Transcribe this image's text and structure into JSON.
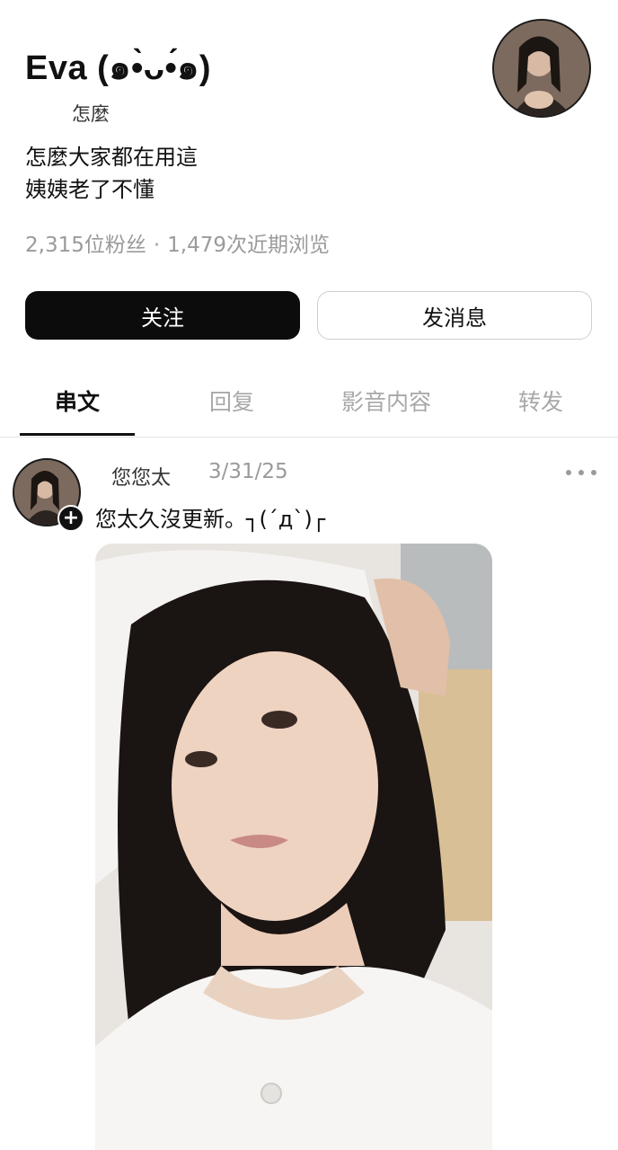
{
  "profile": {
    "display_name": "Eva (๑•̀ᴗ•́๑)",
    "username": "怎麼",
    "bio_lines": [
      "怎麼大家都在用這",
      "姨姨老了不懂"
    ],
    "followers": "2,315位粉丝",
    "separator": "·",
    "views": "1,479次近期浏览"
  },
  "buttons": {
    "follow": "关注",
    "message": "发消息"
  },
  "tabs": [
    {
      "label": "串文",
      "active": true
    },
    {
      "label": "回复",
      "active": false
    },
    {
      "label": "影音内容",
      "active": false
    },
    {
      "label": "转发",
      "active": false
    }
  ],
  "post": {
    "author": "您您太",
    "date": "3/31/25",
    "text": "您太久沒更新。┐(´д`)┌",
    "follow_icon": "+",
    "more_icon": "more-horizontal-icon"
  },
  "colors": {
    "primary": "#0c0c0c",
    "muted": "#9a9a9a",
    "divider": "#e3e3e3"
  }
}
